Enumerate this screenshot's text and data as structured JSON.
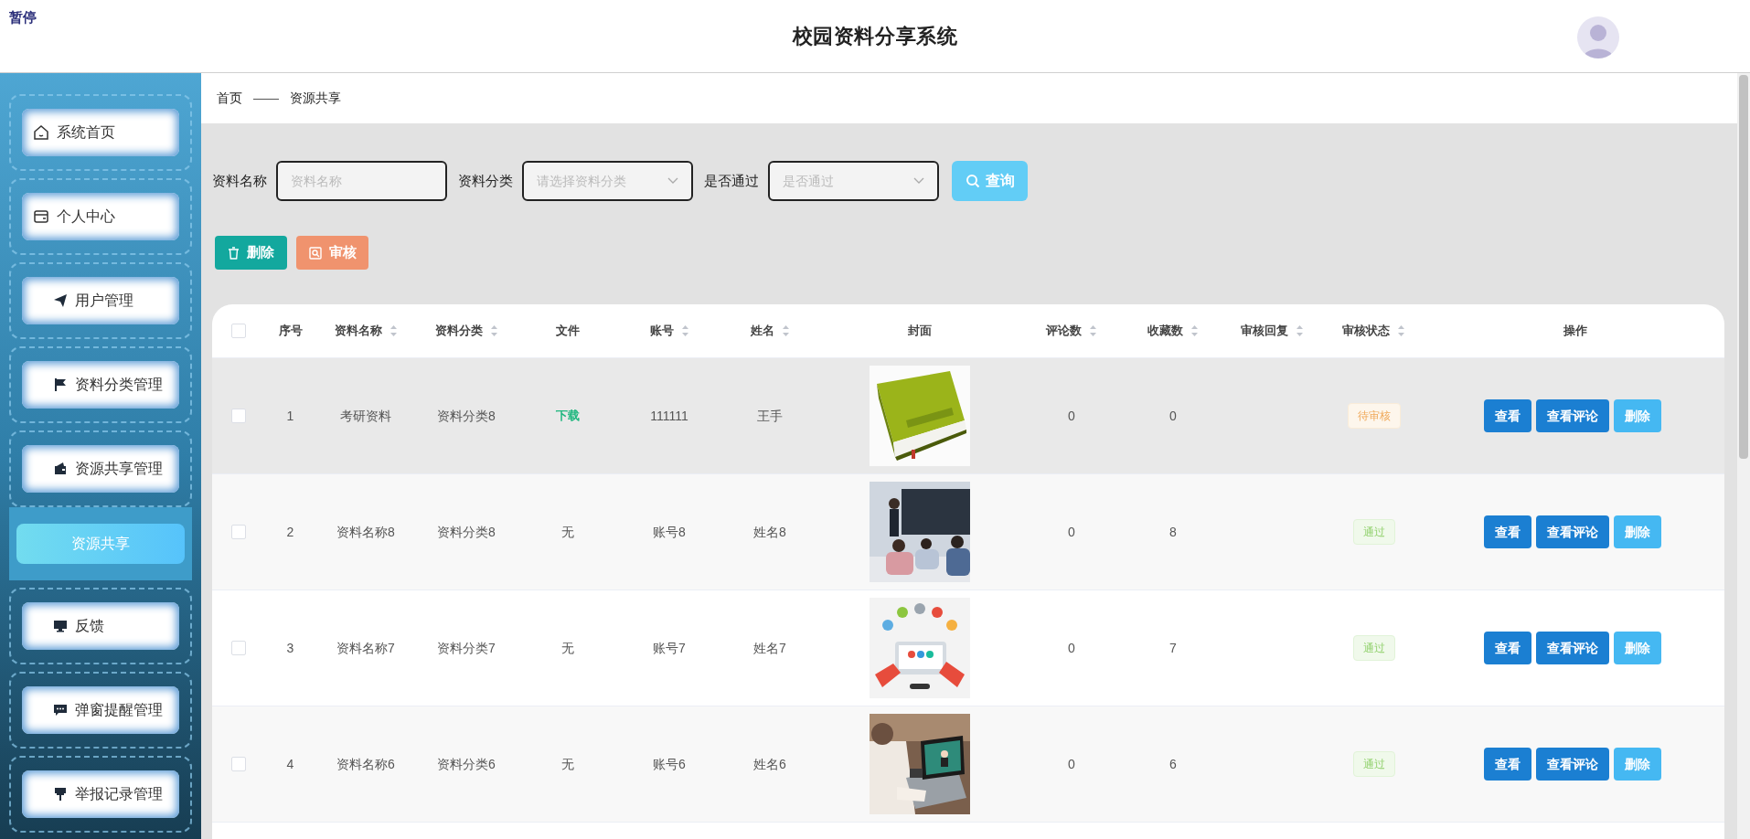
{
  "overlay_label": "暂停",
  "header": {
    "title": "校园资料分享系统",
    "avatar": true
  },
  "sidebar": {
    "items": [
      {
        "label": "系统首页",
        "selected": false
      },
      {
        "label": "个人中心",
        "selected": false
      },
      {
        "label": "用户管理",
        "selected": false
      },
      {
        "label": "资料分类管理",
        "selected": false
      },
      {
        "label": "资源共享管理",
        "selected": false,
        "expanded": true,
        "children": [
          {
            "label": "资源共享",
            "selected": true
          }
        ]
      },
      {
        "label": "反馈",
        "selected": false
      },
      {
        "label": "弹窗提醒管理",
        "selected": false
      },
      {
        "label": "举报记录管理",
        "selected": false
      }
    ]
  },
  "breadcrumb": {
    "items": [
      "首页",
      "资源共享"
    ],
    "separator": "——"
  },
  "filters": [
    {
      "kind": "text",
      "label": "资料名称",
      "placeholder": "资料名称"
    },
    {
      "kind": "select",
      "label": "资料分类",
      "placeholder": "请选择资料分类"
    },
    {
      "kind": "select",
      "label": "是否通过",
      "placeholder": "是否通过"
    }
  ],
  "search_button": "查询",
  "action_buttons": [
    {
      "kind": "delete",
      "label": "删除"
    },
    {
      "kind": "review",
      "label": "审核"
    }
  ],
  "table": {
    "header_checked": false,
    "columns": [
      {
        "label": "序号",
        "sortable": false
      },
      {
        "label": "资料名称",
        "sortable": true
      },
      {
        "label": "资料分类",
        "sortable": true
      },
      {
        "label": "文件",
        "sortable": false
      },
      {
        "label": "账号",
        "sortable": true
      },
      {
        "label": "姓名",
        "sortable": true
      },
      {
        "label": "封面",
        "sortable": false
      },
      {
        "label": "评论数",
        "sortable": true
      },
      {
        "label": "收藏数",
        "sortable": true
      },
      {
        "label": "审核回复",
        "sortable": true
      },
      {
        "label": "审核状态",
        "sortable": true
      },
      {
        "label": "操作",
        "sortable": false
      }
    ],
    "rows": [
      {
        "checked": false,
        "highlighted": true,
        "index": "1",
        "name": "考研资料",
        "category": "资料分类8",
        "file": {
          "kind": "link",
          "text": "下载"
        },
        "account": "111111",
        "person": "王手",
        "cover": {
          "kind": "picture"
        },
        "comments": "0",
        "favorites": "0",
        "status": {
          "kind": "pending",
          "text": "待审核"
        },
        "actions": [
          {
            "kind": "primary",
            "label": "查看"
          },
          {
            "kind": "primary",
            "label": "查看评论"
          },
          {
            "kind": "light",
            "label": "删除"
          }
        ]
      },
      {
        "checked": false,
        "highlighted": false,
        "index": "2",
        "name": "资料名称8",
        "category": "资料分类8",
        "file": {
          "kind": "text",
          "text": "无"
        },
        "account": "账号8",
        "person": "姓名8",
        "cover": {
          "kind": "picture"
        },
        "comments": "0",
        "favorites": "8",
        "status": {
          "kind": "passed",
          "text": "通过"
        },
        "actions": [
          {
            "kind": "primary",
            "label": "查看"
          },
          {
            "kind": "primary",
            "label": "查看评论"
          },
          {
            "kind": "light",
            "label": "删除"
          }
        ]
      },
      {
        "checked": false,
        "highlighted": false,
        "index": "3",
        "name": "资料名称7",
        "category": "资料分类7",
        "file": {
          "kind": "text",
          "text": "无"
        },
        "account": "账号7",
        "person": "姓名7",
        "cover": {
          "kind": "picture"
        },
        "comments": "0",
        "favorites": "7",
        "status": {
          "kind": "passed",
          "text": "通过"
        },
        "actions": [
          {
            "kind": "primary",
            "label": "查看"
          },
          {
            "kind": "primary",
            "label": "查看评论"
          },
          {
            "kind": "light",
            "label": "删除"
          }
        ]
      },
      {
        "checked": false,
        "highlighted": false,
        "index": "4",
        "name": "资料名称6",
        "category": "资料分类6",
        "file": {
          "kind": "text",
          "text": "无"
        },
        "account": "账号6",
        "person": "姓名6",
        "cover": {
          "kind": "picture"
        },
        "comments": "0",
        "favorites": "6",
        "status": {
          "kind": "passed",
          "text": "通过"
        },
        "actions": [
          {
            "kind": "primary",
            "label": "查看"
          },
          {
            "kind": "primary",
            "label": "查看评论"
          },
          {
            "kind": "light",
            "label": "删除"
          }
        ]
      }
    ]
  }
}
